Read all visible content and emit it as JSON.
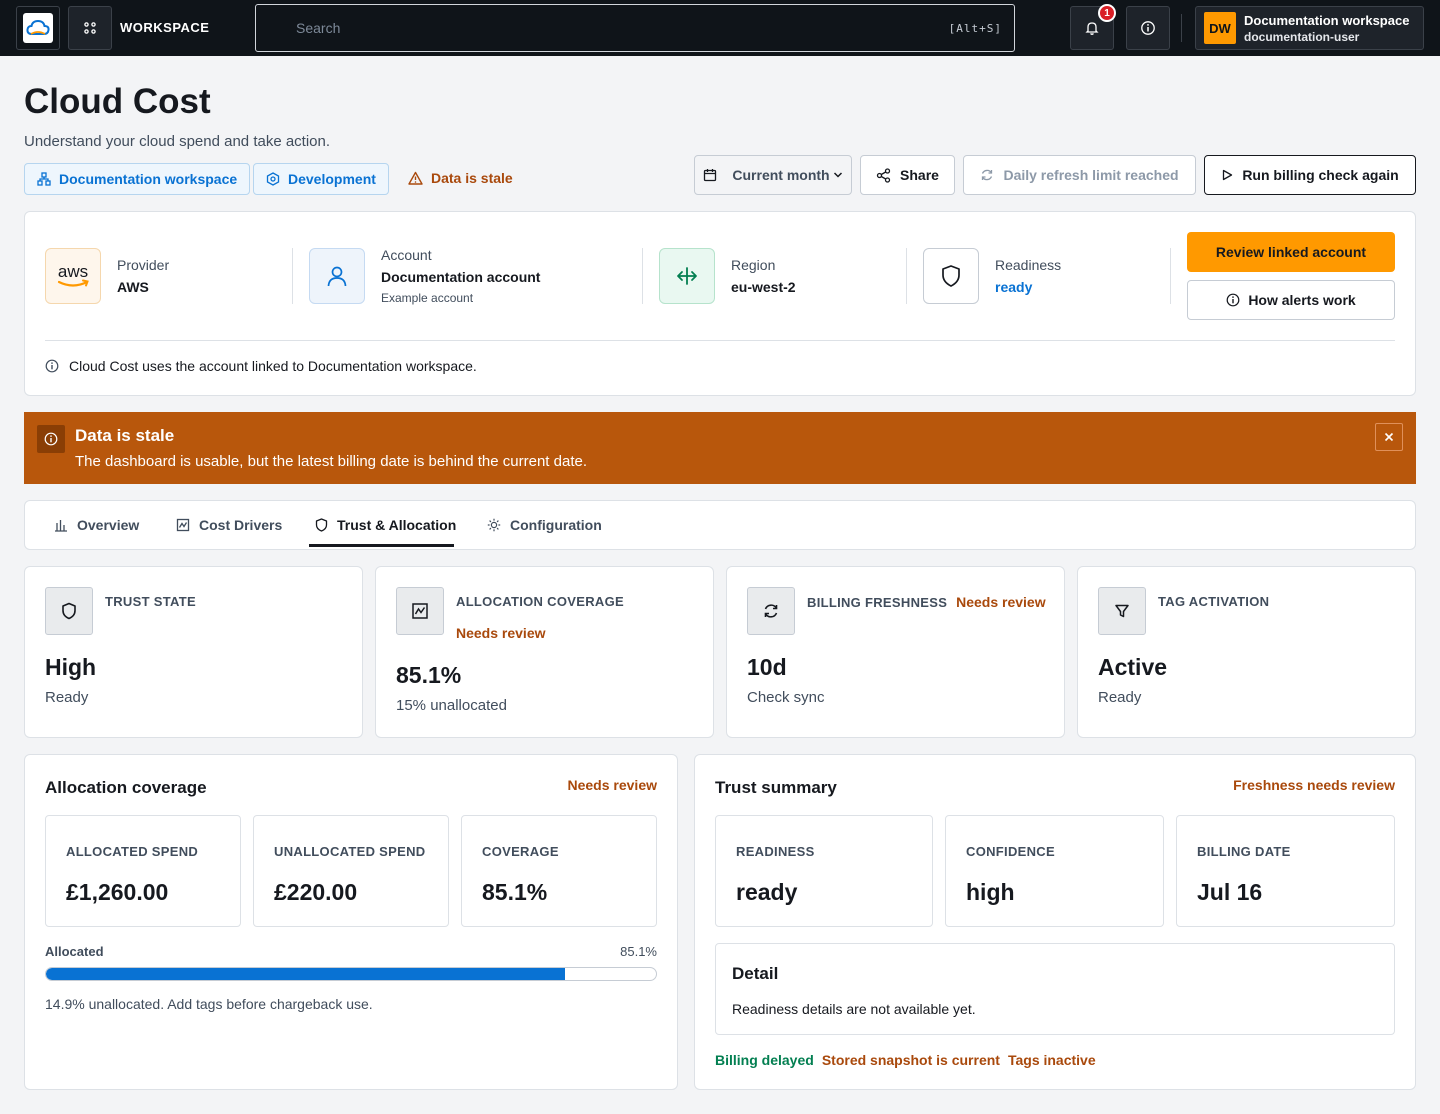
{
  "topbar": {
    "workspace_label": "WORKSPACE",
    "search_placeholder": "Search",
    "search_shortcut": "[Alt+S]",
    "notification_count": "1",
    "user": {
      "initials": "DW",
      "name": "Documentation workspace",
      "username": "documentation-user"
    }
  },
  "header": {
    "title": "Cloud Cost",
    "subtitle": "Understand your cloud spend and take action.",
    "chips": {
      "workspace": "Documentation workspace",
      "environment": "Development",
      "stale": "Data is stale"
    },
    "actions": {
      "period": "Current month",
      "share": "Share",
      "refresh": "Daily refresh limit reached",
      "run": "Run billing check again"
    }
  },
  "account": {
    "provider_label": "Provider",
    "provider_value": "AWS",
    "provider_logo": "aws",
    "account_label": "Account",
    "account_value": "Documentation account",
    "account_sub": "Example account",
    "region_label": "Region",
    "region_value": "eu-west-2",
    "readiness_label": "Readiness",
    "readiness_value": "ready",
    "review_button": "Review linked account",
    "alerts_button": "How alerts work",
    "note": "Cloud Cost uses the account linked to Documentation workspace."
  },
  "banner": {
    "title": "Data is stale",
    "text": "The dashboard is usable, but the latest billing date is behind the current date."
  },
  "tabs": [
    {
      "label": "Overview",
      "icon": "bar-chart-icon"
    },
    {
      "label": "Cost Drivers",
      "icon": "activity-icon"
    },
    {
      "label": "Trust & Allocation",
      "icon": "shield-icon",
      "active": true
    },
    {
      "label": "Configuration",
      "icon": "sun-gear-icon"
    }
  ],
  "metrics": [
    {
      "title": "TRUST STATE",
      "flag": "",
      "value": "High",
      "sub": "Ready",
      "icon": "shield-icon"
    },
    {
      "title": "ALLOCATION COVERAGE",
      "flag": "Needs review",
      "value": "85.1%",
      "sub": "15% unallocated",
      "icon": "activity-icon"
    },
    {
      "title": "BILLING FRESHNESS",
      "flag": "Needs review",
      "value": "10d",
      "sub": "Check sync",
      "icon": "refresh-icon"
    },
    {
      "title": "TAG ACTIVATION",
      "flag": "",
      "value": "Active",
      "sub": "Ready",
      "icon": "filter-icon"
    }
  ],
  "allocation": {
    "title": "Allocation coverage",
    "flag": "Needs review",
    "stats": [
      {
        "label": "ALLOCATED SPEND",
        "value": "£1,260.00"
      },
      {
        "label": "UNALLOCATED SPEND",
        "value": "£220.00"
      },
      {
        "label": "COVERAGE",
        "value": "85.1%"
      }
    ],
    "bar_label": "Allocated",
    "bar_pct_text": "85.1%",
    "bar_fraction": 0.851,
    "note": "14.9% unallocated. Add tags before chargeback use."
  },
  "trust": {
    "title": "Trust summary",
    "flag": "Freshness needs review",
    "stats": [
      {
        "label": "READINESS",
        "value": "ready"
      },
      {
        "label": "CONFIDENCE",
        "value": "high"
      },
      {
        "label": "BILLING DATE",
        "value": "Jul 16"
      }
    ],
    "detail_title": "Detail",
    "detail_text": "Readiness details are not available yet.",
    "tags": [
      {
        "text": "Billing delayed",
        "color": "#037f51"
      },
      {
        "text": "Stored snapshot is current",
        "color": "#a9490c"
      },
      {
        "text": "Tags inactive",
        "color": "#a9490c"
      }
    ]
  },
  "colors": {
    "accent": "#ff9900",
    "link": "#0972d3",
    "warning": "#a9490c",
    "banner": "#b8570c",
    "success": "#037f51"
  }
}
